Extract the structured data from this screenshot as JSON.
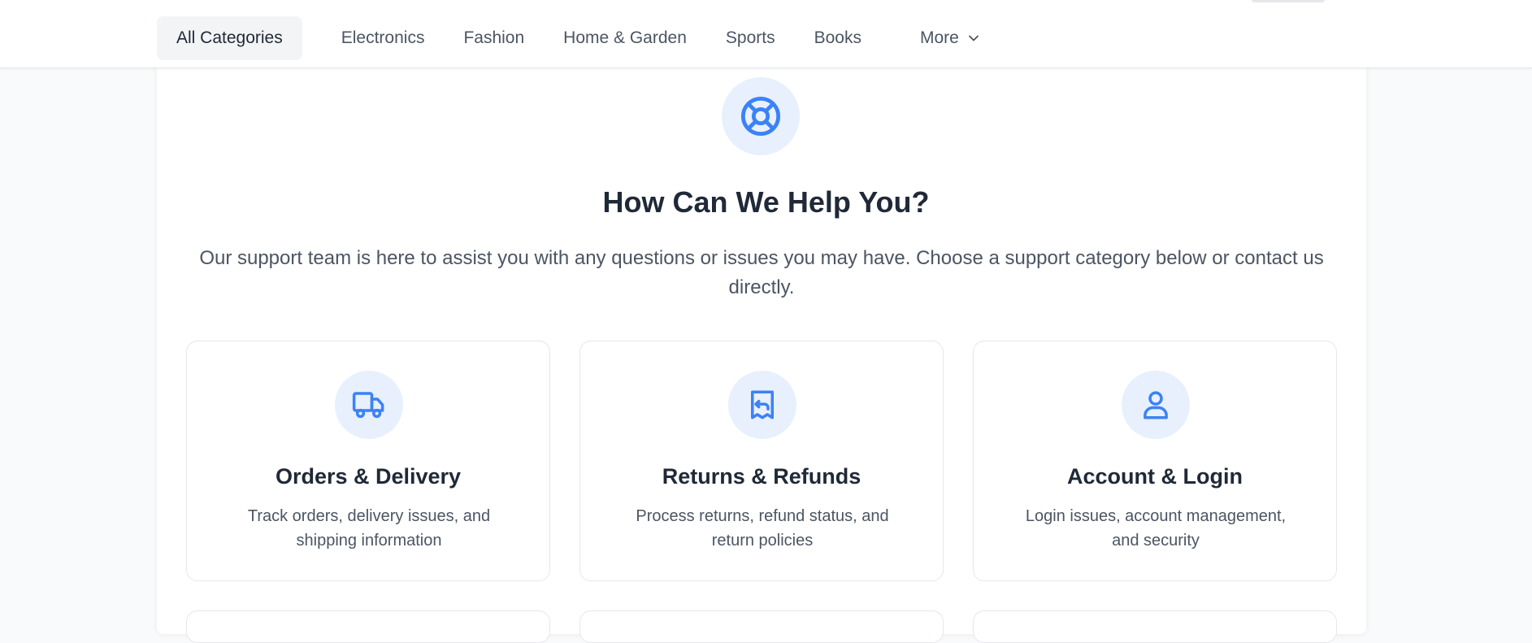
{
  "nav": {
    "items": [
      {
        "label": "All Categories"
      },
      {
        "label": "Electronics"
      },
      {
        "label": "Fashion"
      },
      {
        "label": "Home & Garden"
      },
      {
        "label": "Sports"
      },
      {
        "label": "Books"
      }
    ],
    "more_label": "More",
    "more_icon": "chevron-down-icon"
  },
  "help": {
    "icon": "life-buoy-icon",
    "title": "How Can We Help You?",
    "subtitle": "Our support team is here to assist you with any questions or issues you may have. Choose a support category below or contact us directly."
  },
  "categories": [
    {
      "icon": "truck-icon",
      "title": "Orders & Delivery",
      "description": "Track orders, delivery issues, and shipping information"
    },
    {
      "icon": "receipt-return-icon",
      "title": "Returns & Refunds",
      "description": "Process returns, refund status, and return policies"
    },
    {
      "icon": "user-icon",
      "title": "Account & Login",
      "description": "Login issues, account management, and security"
    }
  ],
  "colors": {
    "accent": "#3b82f6",
    "icon_bg": "#e8f0fd",
    "heading": "#1f2937",
    "body_text": "#4b5563",
    "border": "#e5e7eb"
  }
}
